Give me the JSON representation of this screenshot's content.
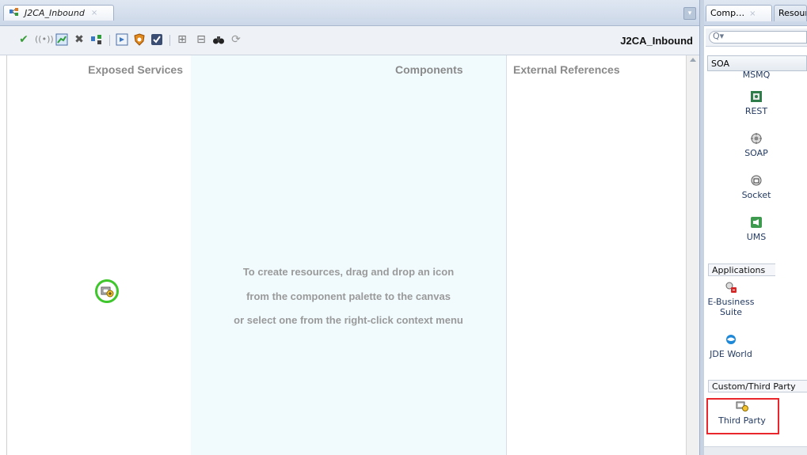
{
  "editor": {
    "tab_label": "J2CA_Inbound",
    "tab_close": "×",
    "composite_name": "J2CA_Inbound"
  },
  "toolbar": {
    "icons": [
      "validate-icon",
      "wireless-icon",
      "chart-icon",
      "delete-icon",
      "deploy-icon",
      "service-icon",
      "security-icon",
      "checkbox-icon",
      "collapse-icon",
      "expand-icon",
      "find-icon",
      "refresh-icon"
    ]
  },
  "canvas": {
    "lane_exposed": "Exposed Services",
    "lane_components": "Components",
    "lane_external": "External References",
    "hint_line1": "To create resources, drag and drop an icon",
    "hint_line2": "from the component palette to the canvas",
    "hint_line3": "or select one from the right-click context menu",
    "dropped_icon": "third-party-adapter-icon",
    "dropped_icon_ring_color": "#3fc62c"
  },
  "palette": {
    "tab_components": "Comp…",
    "tab_resources": "Resour",
    "tab_close": "×",
    "search_placeholder": "",
    "dropdown_value": "SOA",
    "items": [
      {
        "label": "MSMQ"
      },
      {
        "label": "REST"
      },
      {
        "label": "SOAP"
      },
      {
        "label": "Socket"
      },
      {
        "label": "UMS"
      },
      {
        "label": "E-Business Suite"
      },
      {
        "label": "JDE World"
      },
      {
        "label": "Third Party"
      }
    ],
    "categories": {
      "applications": "Applications",
      "custom": "Custom/Third Party"
    },
    "highlight_color": "#e8262c"
  }
}
